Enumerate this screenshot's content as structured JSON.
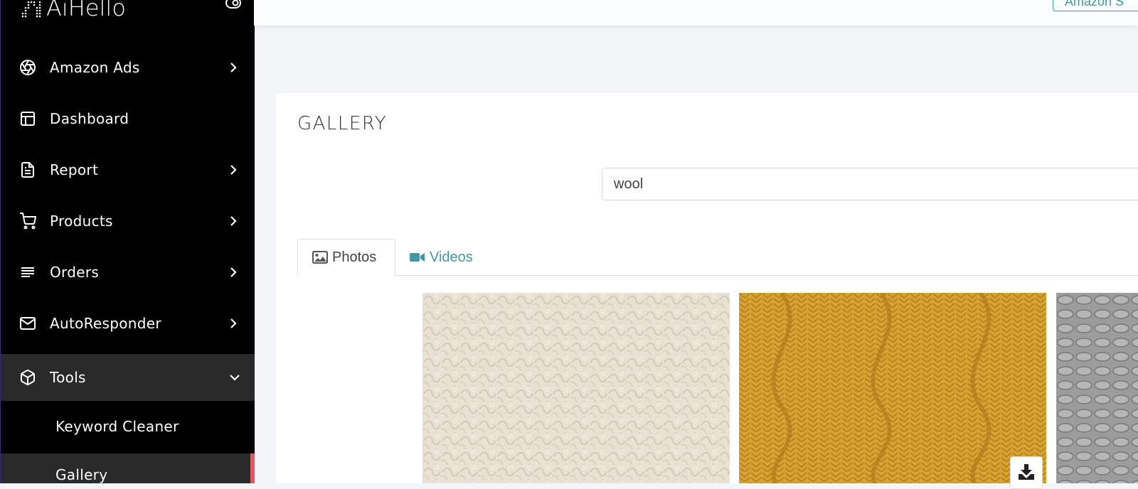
{
  "app": {
    "logo_text": "AiHello"
  },
  "sidebar": {
    "items": [
      {
        "label": "Amazon Ads",
        "icon": "aperture-icon"
      },
      {
        "label": "Dashboard",
        "icon": "layout-icon"
      },
      {
        "label": "Report",
        "icon": "file-text-icon"
      },
      {
        "label": "Products",
        "icon": "cart-icon"
      },
      {
        "label": "Orders",
        "icon": "lines-icon"
      },
      {
        "label": "AutoResponder",
        "icon": "mail-icon"
      },
      {
        "label": "Tools",
        "icon": "box-icon"
      }
    ],
    "tools_subitems": [
      {
        "label": "Keyword Cleaner"
      },
      {
        "label": "Gallery"
      }
    ]
  },
  "topbar": {
    "button_label": "Amazon S"
  },
  "page": {
    "title": "GALLERY"
  },
  "search": {
    "value": "wool"
  },
  "tabs": [
    {
      "label": "Photos",
      "icon": "image-icon"
    },
    {
      "label": "Videos",
      "icon": "video-camera-icon"
    }
  ],
  "colors": {
    "accent": "#3d9aa6",
    "sidebar_bg": "#000000",
    "active_bg": "#2a2a2a",
    "active_marker": "#e8575e"
  }
}
